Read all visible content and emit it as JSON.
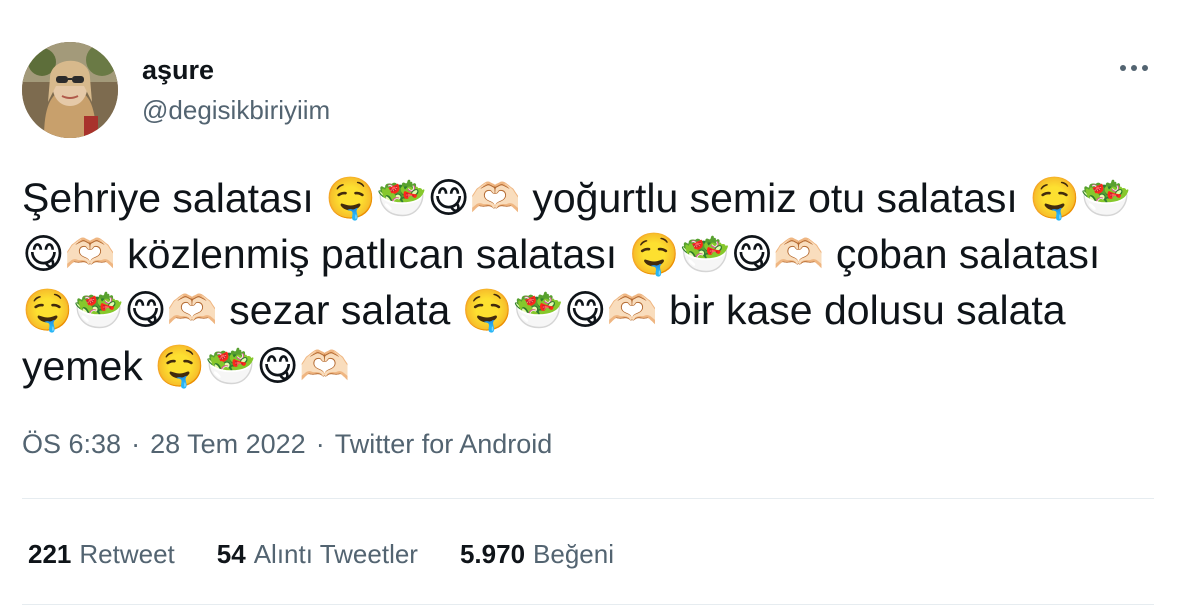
{
  "user": {
    "display_name": "aşure",
    "handle": "@degisikbiriyiim"
  },
  "more_icon": "more-horizontal-icon",
  "tweet": {
    "text": "Şehriye salatası 🤤🥗😋🫶🏻 yoğurtlu semiz otu salatası 🤤🥗😋🫶🏻 közlenmiş patlıcan salatası 🤤🥗😋🫶🏻 çoban salatası 🤤🥗😋🫶🏻 sezar salata 🤤🥗😋🫶🏻 bir kase dolusu salata yemek 🤤🥗😋🫶🏻"
  },
  "meta": {
    "time": "ÖS 6:38",
    "date": "28 Tem 2022",
    "separator": "·",
    "source": "Twitter for Android"
  },
  "stats": {
    "retweets": {
      "count": "221",
      "label": "Retweet"
    },
    "quotes": {
      "count": "54",
      "label": "Alıntı Tweetler"
    },
    "likes": {
      "count": "5.970",
      "label": "Beğeni"
    }
  }
}
